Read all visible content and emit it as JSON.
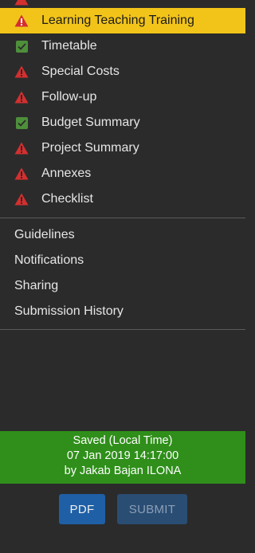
{
  "nav": {
    "items": [
      {
        "label": "Learning Teaching Training",
        "status": "warning",
        "active": true
      },
      {
        "label": "Timetable",
        "status": "complete",
        "active": false
      },
      {
        "label": "Special Costs",
        "status": "warning",
        "active": false
      },
      {
        "label": "Follow-up",
        "status": "warning",
        "active": false
      },
      {
        "label": "Budget Summary",
        "status": "complete",
        "active": false
      },
      {
        "label": "Project Summary",
        "status": "warning",
        "active": false
      },
      {
        "label": "Annexes",
        "status": "warning",
        "active": false
      },
      {
        "label": "Checklist",
        "status": "warning",
        "active": false
      }
    ]
  },
  "links": {
    "guidelines": "Guidelines",
    "notifications": "Notifications",
    "sharing": "Sharing",
    "submission_history": "Submission History"
  },
  "save_status": {
    "line1": "Saved (Local Time)",
    "line2": "07 Jan 2019 14:17:00",
    "line3": "by Jakab Bajan ILONA"
  },
  "actions": {
    "pdf_label": "PDF",
    "submit_label": "SUBMIT"
  },
  "icons": {
    "warning": "warning-triangle-icon",
    "complete": "check-icon"
  },
  "colors": {
    "background": "#2b2b2b",
    "active_item": "#f2c419",
    "warning": "#d32f2f",
    "complete": "#4e8f3a",
    "saved_banner": "#2f8f1a",
    "pdf_button": "#1f5fa6",
    "submit_button_disabled": "#2a4d73"
  }
}
